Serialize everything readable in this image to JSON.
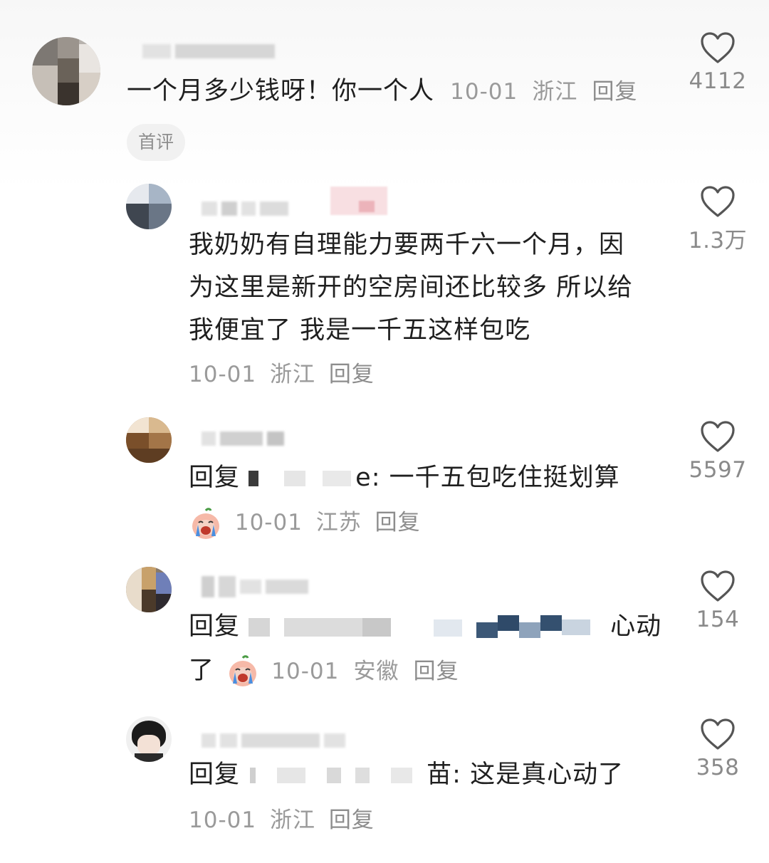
{
  "comments": [
    {
      "text": "一个月多少钱呀！你一个人",
      "date": "10-01",
      "location": "浙江",
      "reply_label": "回复",
      "badge": "首评",
      "likes": "4112"
    },
    {
      "lines": [
        "我奶奶有自理能力要两千六一个月，因",
        "为这里是新开的空房间还比较多 所以给",
        "我便宜了 我是一千五这样包吃"
      ],
      "date": "10-01",
      "location": "浙江",
      "reply_label": "回复",
      "likes": "1.3万"
    },
    {
      "prefix": "回复",
      "text_visible": "e: 一千五包吃住挺划算",
      "date": "10-01",
      "location": "江苏",
      "reply_label": "回复",
      "likes": "5597"
    },
    {
      "prefix": "回复",
      "text_visible": "心动",
      "line2": "了",
      "date": "10-01",
      "location": "安徽",
      "reply_label": "回复",
      "likes": "154"
    },
    {
      "prefix": "回复",
      "text_visible": "苗: 这是真心动了",
      "date": "10-01",
      "location": "浙江",
      "reply_label": "回复",
      "likes": "358"
    }
  ],
  "icons": {
    "like": "heart-outline-icon",
    "emoji": "crying-peach-emoji"
  },
  "colors": {
    "text": "#1f1f1f",
    "meta": "#9a9a9a",
    "heart": "#555555",
    "badge_bg": "#f1f1f1"
  }
}
